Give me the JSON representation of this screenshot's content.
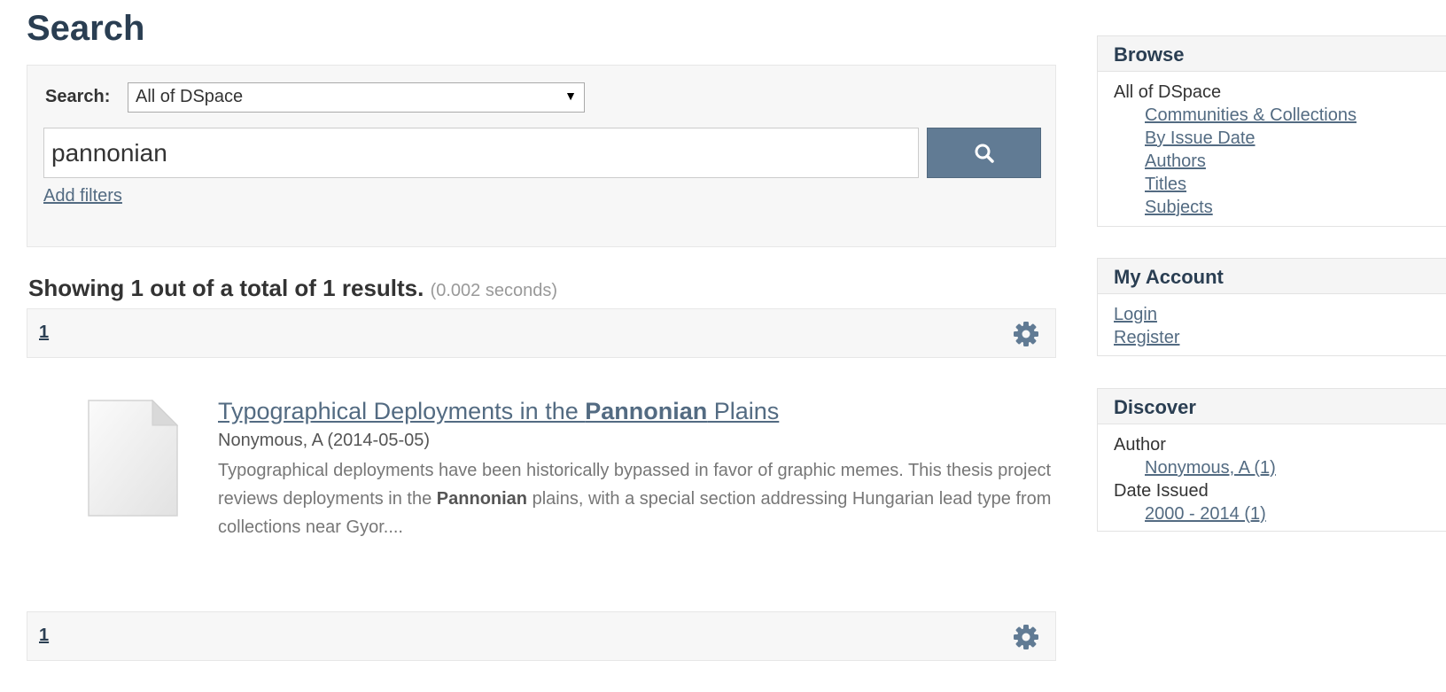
{
  "page": {
    "title": "Search"
  },
  "search": {
    "scope_label": "Search:",
    "scope_value": "All of DSpace",
    "query": "pannonian",
    "add_filters": "Add filters",
    "button_icon": "search-icon"
  },
  "results": {
    "summary": "Showing 1 out of a total of 1 results.",
    "timing": "(0.002 seconds)",
    "page_number": "1",
    "settings_icon": "gear-icon"
  },
  "item": {
    "title_prefix": "Typographical Deployments in the ",
    "title_highlight": "Pannonian",
    "title_suffix": " Plains",
    "meta": "Nonymous, A (2014-05-05)",
    "abstract_prefix": "Typographical deployments have been historically bypassed in favor of graphic memes. This thesis project reviews deployments in the ",
    "abstract_highlight": "Pannonian",
    "abstract_suffix": " plains, with a special section addressing Hungarian lead type from collections near Gyor....",
    "thumbnail_icon": "document-icon"
  },
  "sidebar": {
    "browse": {
      "heading": "Browse",
      "group": "All of DSpace",
      "links": [
        "Communities & Collections",
        "By Issue Date",
        "Authors",
        "Titles",
        "Subjects"
      ]
    },
    "account": {
      "heading": "My Account",
      "links": [
        "Login",
        "Register"
      ]
    },
    "discover": {
      "heading": "Discover",
      "author_label": "Author",
      "author_value": "Nonymous, A (1)",
      "date_label": "Date Issued",
      "date_value": "2000 - 2014 (1)"
    }
  },
  "colors": {
    "title": "#2a3e52",
    "link": "#536b82",
    "button": "#617b94",
    "panel_bg": "#f7f7f7"
  }
}
